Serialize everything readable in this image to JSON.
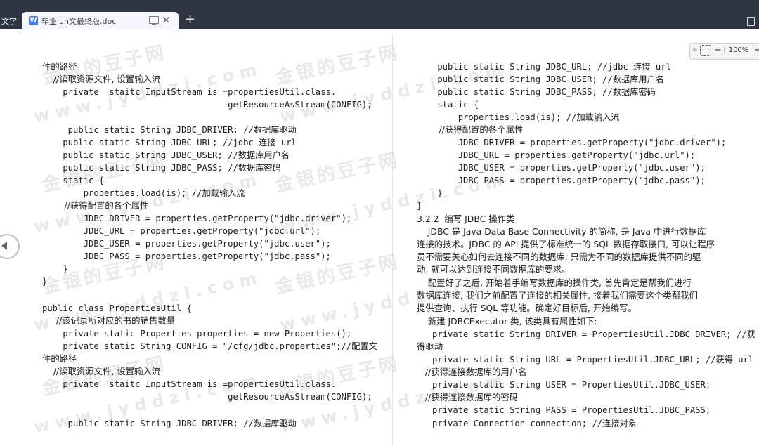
{
  "tabbar": {
    "left_tab_label": "文字",
    "active_tab_title": "毕业lun文最终版.doc",
    "doc_icon": "W",
    "close_icon": "×",
    "add_icon": "+"
  },
  "zoom": {
    "value": "100%",
    "minus": "−",
    "plus": "+"
  },
  "watermark": {
    "cn": "金银的豆子网",
    "en": "www.jyddzi.com"
  },
  "left_column": [
    "件的路径",
    "    //读取资源文件, 设置输入流",
    "    private  staitc InputStream is =propertiesUtil.class.",
    "                                    getResourceAsStream(CONFIG);",
    "",
    "     public static String JDBC_DRIVER; //数据库驱动",
    "    public static String JDBC_URL; //jdbc 连接 url",
    "    public static String JDBC_USER; //数据库用户名",
    "    public static String JDBC_PASS; //数据库密码",
    "    static {",
    "        properties.load(is); //加载输入流",
    "        //获得配置的各个属性",
    "        JDBC_DRIVER = properties.getProperty(\"jdbc.driver\");",
    "        JDBC_URL = properties.getProperty(\"jdbc.url\");",
    "        JDBC_USER = properties.getProperty(\"jdbc.user\");",
    "        JDBC_PASS = properties.getProperty(\"jdbc.pass\");",
    "    }",
    "}",
    "",
    "public class PropertiesUtil {",
    "     //该记录所对应的书的销售数量",
    "    private static Properties properties = new Properties();",
    "    private static String CONFIG = \"/cfg/jdbc.properties\";//配置文",
    "件的路径",
    "    //读取资源文件, 设置输入流",
    "    private  staitc InputStream is =propertiesUtil.class.",
    "                                    getResourceAsStream(CONFIG);",
    "",
    "     public static String JDBC_DRIVER; //数据库驱动"
  ],
  "right_column": [
    "    public static String JDBC_URL; //jdbc 连接 url",
    "    public static String JDBC_USER; //数据库用户名",
    "    public static String JDBC_PASS; //数据库密码",
    "    static {",
    "        properties.load(is); //加载输入流",
    "        //获得配置的各个属性",
    "        JDBC_DRIVER = properties.getProperty(\"jdbc.driver\");",
    "        JDBC_URL = properties.getProperty(\"jdbc.url\");",
    "        JDBC_USER = properties.getProperty(\"jdbc.user\");",
    "        JDBC_PASS = properties.getProperty(\"jdbc.pass\");",
    "    }",
    "}",
    "3.2.2  编写 JDBC 操作类",
    "    JDBC 是 Java Data Base Connectivity 的简称, 是 Java 中进行数据库",
    "连接的技术。JDBC 的 API 提供了标准统一的 SQL 数据存取接口, 可以让程序",
    "员不需要关心如何去连接不同的数据库, 只需为不同的数据库提供不同的驱",
    "动, 就可以达到连接不同数据库的要求。",
    "    配置好了之后, 开始着手编写数据库的操作类, 首先肯定是帮我们进行",
    "数据库连接, 我们之前配置了连接的相关属性, 接着我们需要这个类帮我们",
    "提供查询、执行 SQL 等功能。确定好目标后, 开始编写。",
    "    新建 JDBCExecutor 类, 该类具有属性如下:",
    "   private static String DRIVER = PropertiesUtil.JDBC_DRIVER; //获",
    "得驱动",
    "   private static String URL = PropertiesUtil.JDBC_URL; //获得 url",
    "   //获得连接数据库的用户名",
    "   private static String USER = PropertiesUtil.JDBC_USER;",
    "   //获得连接数据库的密码",
    "   private static String PASS = PropertiesUtil.JDBC_PASS;",
    "   private Connection connection; //连接对象"
  ]
}
